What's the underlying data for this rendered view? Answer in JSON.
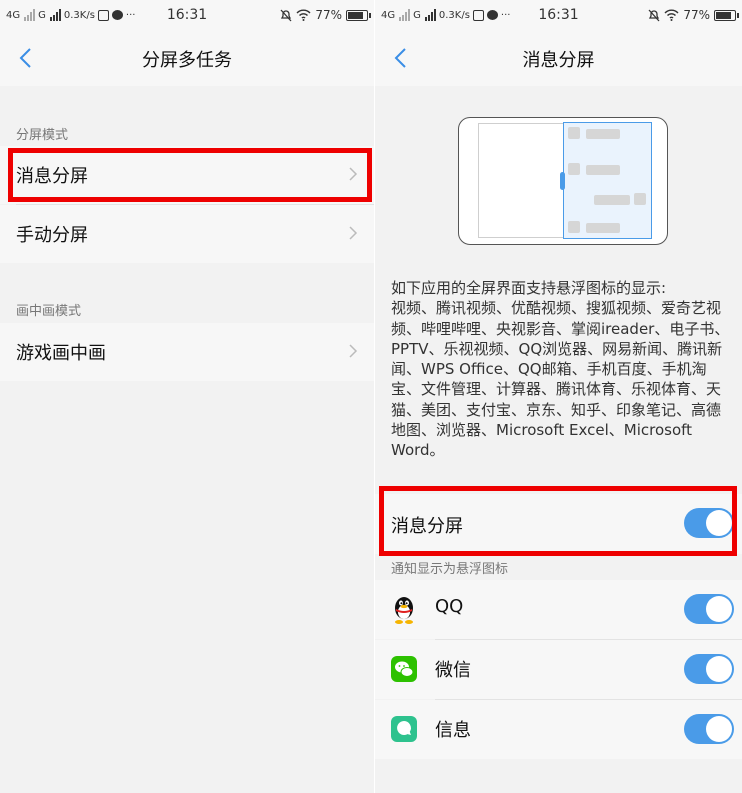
{
  "status_bar": {
    "left_text": "4G",
    "g_text": "G",
    "speed": "0.3K/s",
    "dots": "···",
    "time": "16:31",
    "battery": "77%"
  },
  "left_screen": {
    "title": "分屏多任务",
    "section1_label": "分屏模式",
    "items_split": [
      "消息分屏",
      "手动分屏"
    ],
    "section2_label": "画中画模式",
    "items_pip": [
      "游戏画中画"
    ]
  },
  "right_screen": {
    "title": "消息分屏",
    "description_title": "如下应用的全屏界面支持悬浮图标的显示:",
    "description_body": "视频、腾讯视频、优酷视频、搜狐视频、爱奇艺视频、哔哩哔哩、央视影音、掌阅ireader、电子书、PPTV、乐视视频、QQ浏览器、网易新闻、腾讯新闻、WPS Office、QQ邮箱、手机百度、手机淘宝、文件管理、计算器、腾讯体育、乐视体育、天猫、美团、支付宝、京东、知乎、印象笔记、高德地图、浏览器、Microsoft Excel、Microsoft Word。",
    "main_toggle_label": "消息分屏",
    "main_toggle_on": true,
    "notify_label": "通知显示为悬浮图标",
    "apps": [
      {
        "name": "QQ",
        "icon": "qq-penguin-icon",
        "on": true
      },
      {
        "name": "微信",
        "icon": "wechat-icon",
        "on": true
      },
      {
        "name": "信息",
        "icon": "messages-icon",
        "on": true
      }
    ]
  },
  "colors": {
    "accent": "#4a9be8",
    "highlight_box": "#ee0000",
    "wechat_green": "#2dc100",
    "messages_green": "#2ec28e"
  }
}
